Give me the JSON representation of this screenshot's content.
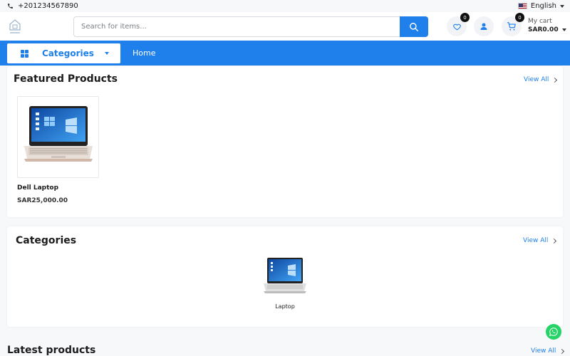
{
  "topbar": {
    "phone": "+201234567890",
    "language": "English"
  },
  "header": {
    "search": {
      "placeholder": "Search for items..."
    },
    "wishlist_count": "0",
    "cart_count": "0",
    "cart_label": "My cart",
    "cart_amount": "SAR0.00"
  },
  "nav": {
    "categories_label": "Categories",
    "home_label": "Home"
  },
  "featured": {
    "title": "Featured Products",
    "view_all": "View All",
    "products": [
      {
        "name": "Dell Laptop",
        "price": "SAR25,000.00"
      }
    ]
  },
  "categories": {
    "title": "Categories",
    "view_all": "View All",
    "items": [
      {
        "name": "Laptop"
      }
    ]
  },
  "latest": {
    "title": "Latest products",
    "view_all": "View All"
  },
  "colors": {
    "primary": "#1f80ec",
    "whatsapp": "#25d366"
  }
}
